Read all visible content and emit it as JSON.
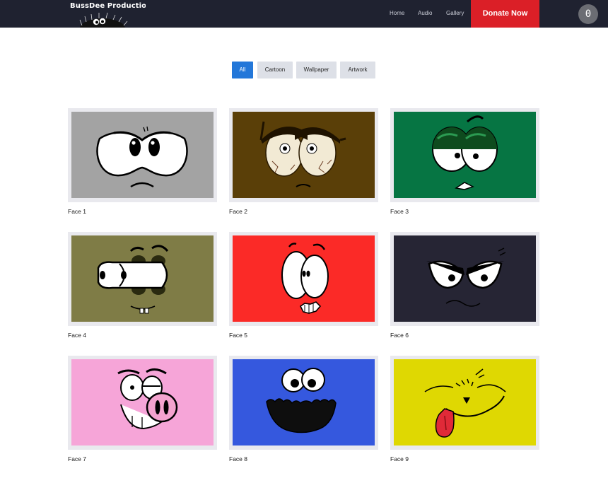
{
  "header": {
    "brand": "BussDee Production",
    "nav": [
      "Home",
      "Audio",
      "Gallery"
    ],
    "donate_label": "Donate Now",
    "cart_count": "0",
    "bg_color": "#1f2230",
    "donate_color": "#db1f27"
  },
  "filters": {
    "items": [
      "All",
      "Cartoon",
      "Wallpaper",
      "Artwork"
    ],
    "active": "All",
    "active_color": "#2377d9"
  },
  "gallery": {
    "items": [
      {
        "caption": "Face 1",
        "bg": "#a3a3a3"
      },
      {
        "caption": "Face 2",
        "bg": "#5a3f08"
      },
      {
        "caption": "Face 3",
        "bg": "#067543"
      },
      {
        "caption": "Face 4",
        "bg": "#7f7c46"
      },
      {
        "caption": "Face 5",
        "bg": "#fb2a27"
      },
      {
        "caption": "Face 6",
        "bg": "#262534"
      },
      {
        "caption": "Face 7",
        "bg": "#f6a5d8"
      },
      {
        "caption": "Face 8",
        "bg": "#3558de"
      },
      {
        "caption": "Face 9",
        "bg": "#dfd802"
      }
    ]
  }
}
